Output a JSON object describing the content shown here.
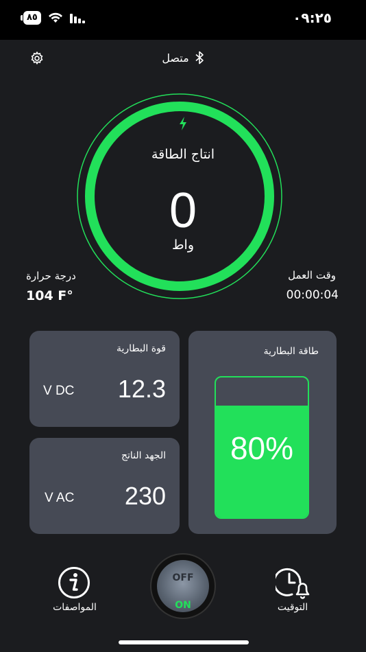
{
  "status_bar": {
    "time": "٠٩:٢٥",
    "battery": "٨٥"
  },
  "header": {
    "connection_status": "متصل"
  },
  "gauge": {
    "title": "انتاج الطاقة",
    "value": "0",
    "unit": "واط"
  },
  "temperature": {
    "label": "درجة حرارة",
    "value": "104 F°"
  },
  "runtime": {
    "label": "وقت العمل",
    "value": "00:00:04"
  },
  "battery_voltage": {
    "title": "قوة البطارية",
    "value": "12.3",
    "unit": "V DC"
  },
  "output_voltage": {
    "title": "الجهد الناتج",
    "value": "230",
    "unit": "V AC"
  },
  "battery_level": {
    "title": "طاقة البطارية",
    "percent_text": "80%",
    "level": 0.8
  },
  "power_switch": {
    "off_label": "OFF",
    "on_label": "ON"
  },
  "nav": {
    "specs_label": "المواصفات",
    "timer_label": "التوقيت"
  },
  "colors": {
    "accent": "#22e05a",
    "card": "#464a55",
    "background": "#1b1c1f"
  }
}
